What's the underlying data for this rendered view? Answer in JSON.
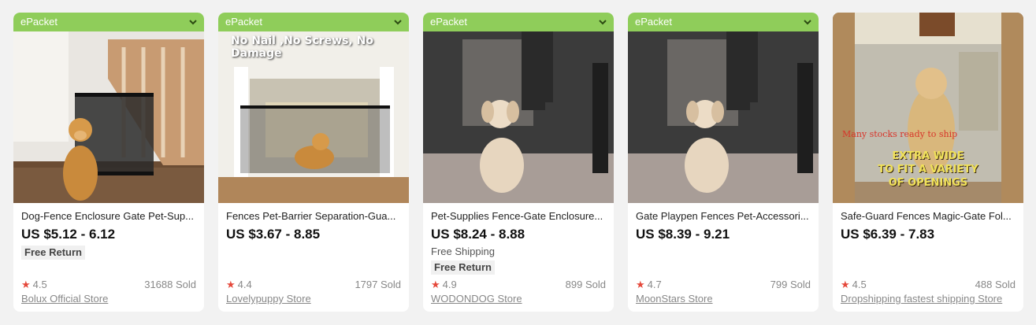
{
  "colors": {
    "badge_bg": "#8fcd5a",
    "star": "#e5483b",
    "page_bg": "#f2f2f2",
    "card_bg": "#ffffff"
  },
  "products": [
    {
      "badge": "ePacket",
      "title": "Dog-Fence Enclosure Gate Pet-Sup...",
      "price": "US $5.12 - 6.12",
      "shipping": "",
      "free_return": "Free Return",
      "rating": "4.5",
      "sold": "31688 Sold",
      "store": "Bolux Official Store",
      "image_overlay": ""
    },
    {
      "badge": "ePacket",
      "title": "Fences Pet-Barrier Separation-Gua...",
      "price": "US $3.67 - 8.85",
      "shipping": "",
      "free_return": "",
      "rating": "4.4",
      "sold": "1797 Sold",
      "store": "Lovelypuppy Store",
      "image_overlay": "No Nail ,No Screws, No Damage"
    },
    {
      "badge": "ePacket",
      "title": "Pet-Supplies Fence-Gate Enclosure...",
      "price": "US $8.24 - 8.88",
      "shipping": "Free Shipping",
      "free_return": "Free Return",
      "rating": "4.9",
      "sold": "899 Sold",
      "store": "WODONDOG Store",
      "image_overlay": ""
    },
    {
      "badge": "ePacket",
      "title": "Gate Playpen Fences Pet-Accessori...",
      "price": "US $8.39 - 9.21",
      "shipping": "",
      "free_return": "",
      "rating": "4.7",
      "sold": "799 Sold",
      "store": "MoonStars Store",
      "image_overlay": ""
    },
    {
      "badge": "",
      "title": "Safe-Guard Fences Magic-Gate Fol...",
      "price": "US $6.39 - 7.83",
      "shipping": "",
      "free_return": "",
      "rating": "4.5",
      "sold": "488 Sold",
      "store": "Dropshipping fastest shipping Store",
      "image_overlay": "Many stocks ready to ship",
      "image_overlay_2": "EXTRA WIDE\nTO FIT A VARIETY\nOF OPENINGS"
    }
  ]
}
